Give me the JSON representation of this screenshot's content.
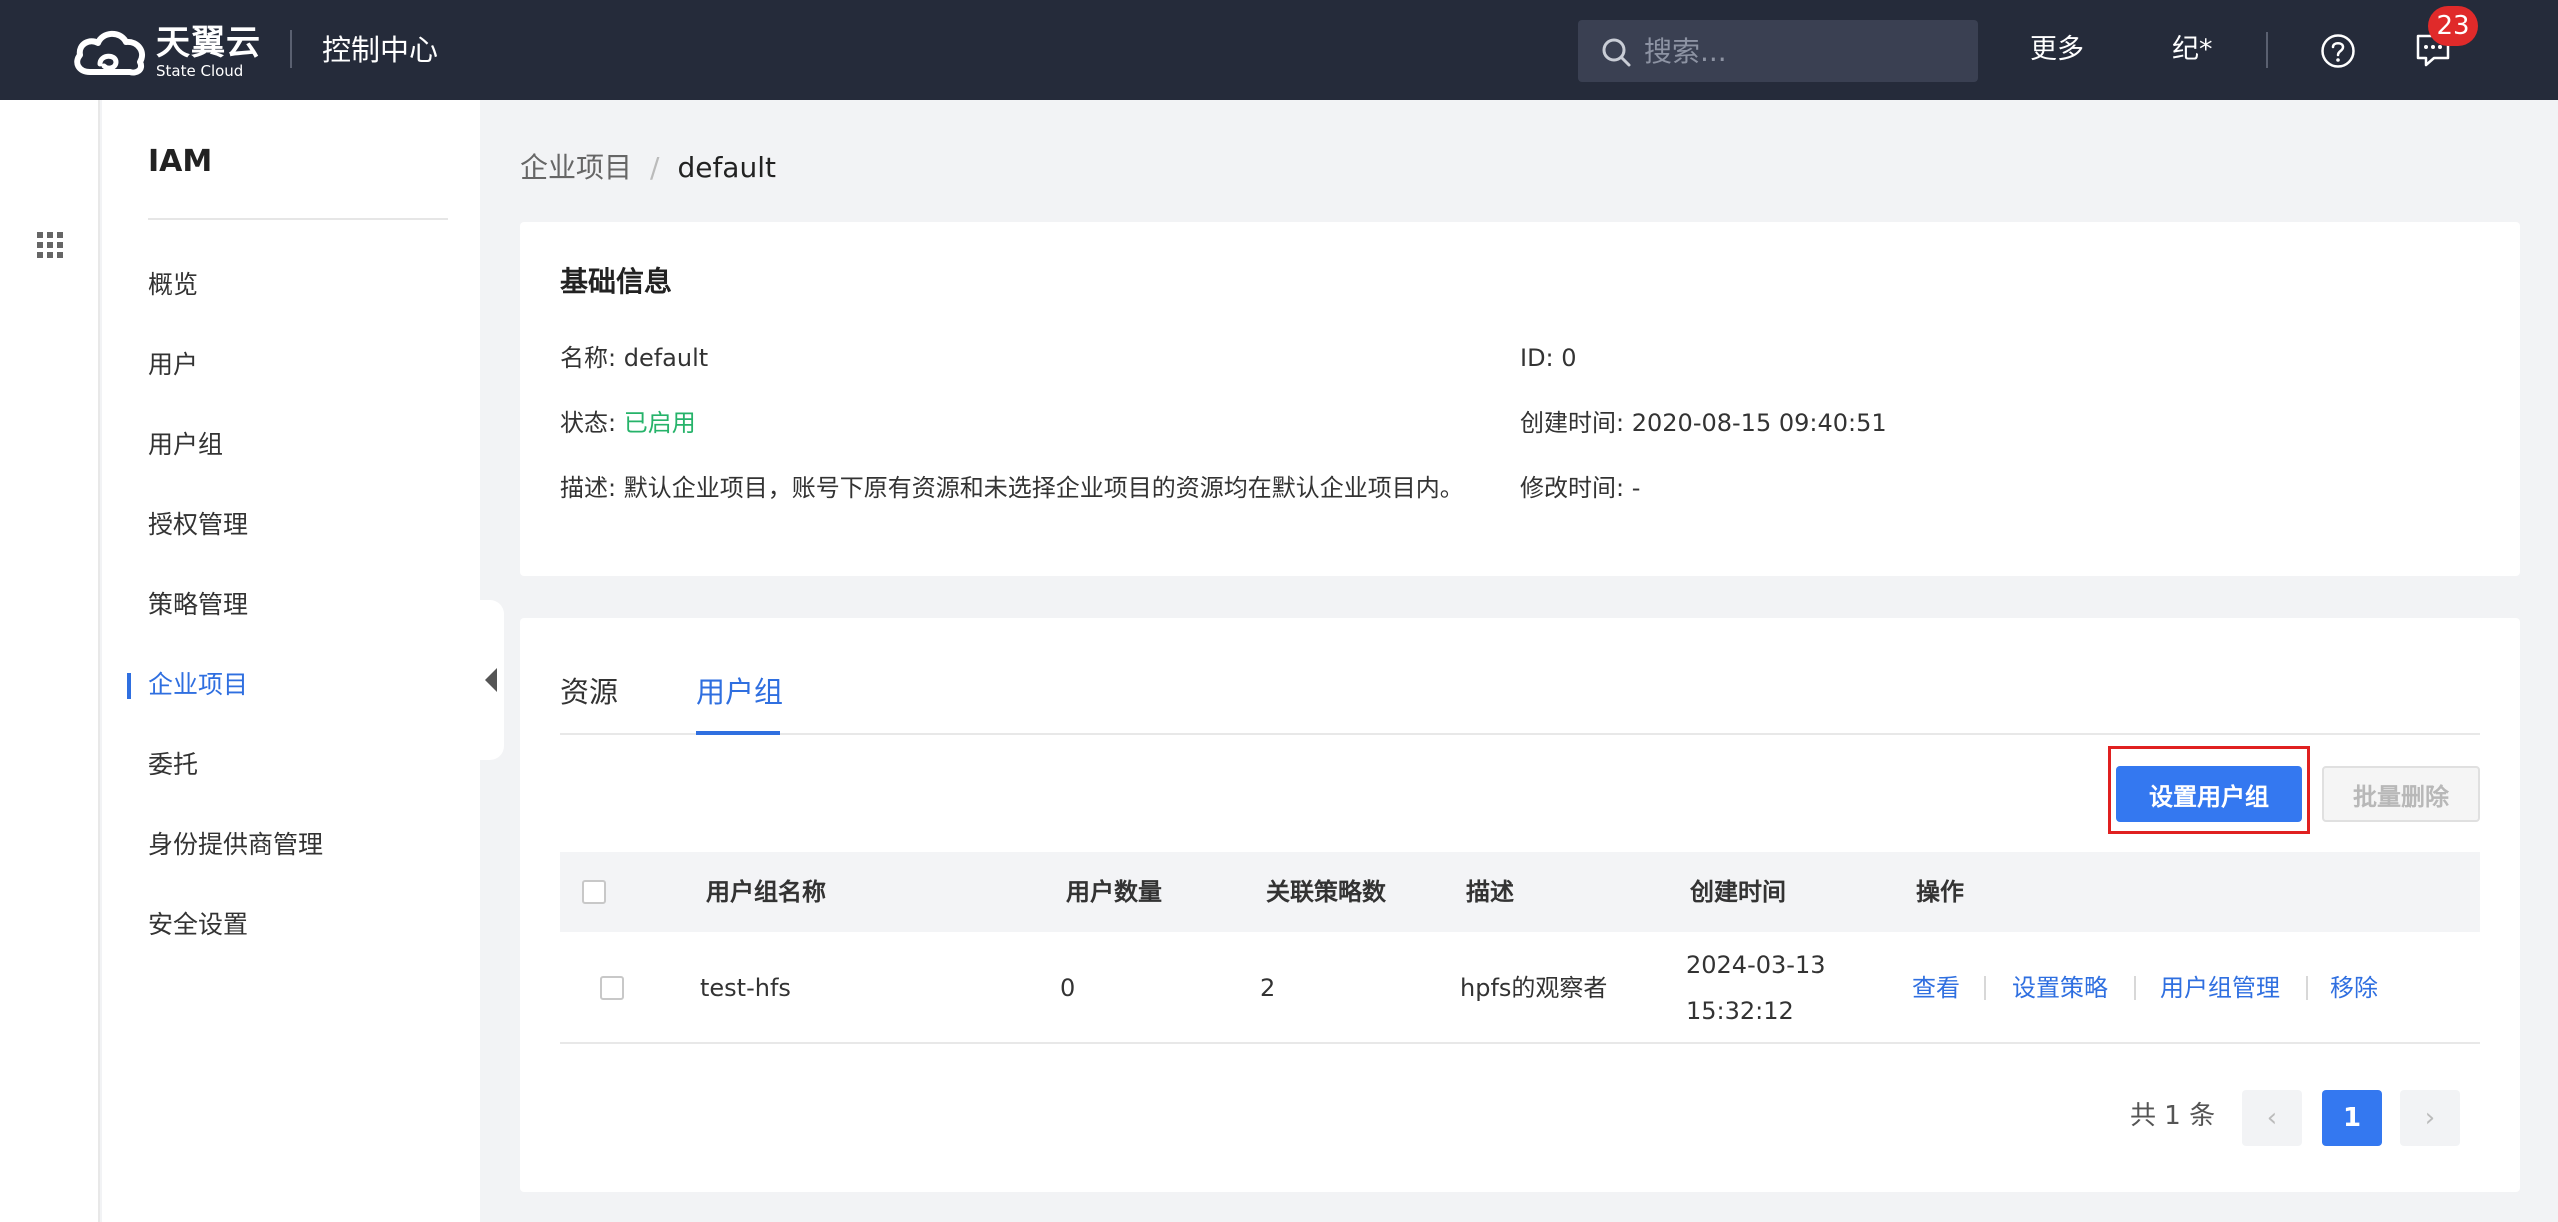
{
  "topbar": {
    "logo_cn": "天翼云",
    "logo_en": "State Cloud",
    "console_title": "控制中心",
    "search_placeholder": "搜索...",
    "more": "更多",
    "user": "纪*",
    "help_icon": "question-circle-icon",
    "message_icon": "chat-bubble-icon",
    "message_badge": "23",
    "background_color": "#252b3a",
    "badge_color": "#e02a2a"
  },
  "leftstrip": {
    "icon": "grid-icon"
  },
  "sidenav": {
    "title": "IAM",
    "items": [
      {
        "label": "概览"
      },
      {
        "label": "用户"
      },
      {
        "label": "用户组"
      },
      {
        "label": "授权管理"
      },
      {
        "label": "策略管理"
      },
      {
        "label": "企业项目",
        "active": true
      },
      {
        "label": "委托"
      },
      {
        "label": "身份提供商管理"
      },
      {
        "label": "安全设置"
      }
    ],
    "active_color": "#2f6fe0"
  },
  "breadcrumb": {
    "parent": "企业项目",
    "separator": "/",
    "current": "default"
  },
  "basic_info": {
    "title": "基础信息",
    "name_label": "名称:",
    "name_value": "default",
    "id_label": "ID:",
    "id_value": "0",
    "status_label": "状态:",
    "status_value": "已启用",
    "status_color": "#26b36a",
    "created_label": "创建时间:",
    "created_value": "2020-08-15 09:40:51",
    "desc_label": "描述:",
    "desc_value": "默认企业项目，账号下原有资源和未选择企业项目的资源均在默认企业项目内。",
    "modified_label": "修改时间:",
    "modified_value": "-"
  },
  "tabs": {
    "items": [
      {
        "label": "资源"
      },
      {
        "label": "用户组",
        "active": true
      }
    ]
  },
  "toolbar": {
    "set_usergroup": "设置用户组",
    "batch_delete": "批量删除",
    "primary_color": "#3478f0",
    "highlight_color": "#e02020"
  },
  "table": {
    "headers": [
      "用户组名称",
      "用户数量",
      "关联策略数",
      "描述",
      "创建时间",
      "操作"
    ],
    "rows": [
      {
        "name": "test-hfs",
        "user_count": "0",
        "policy_count": "2",
        "description": "hpfs的观察者",
        "created": "2024-03-13 15:32:12",
        "actions": [
          "查看",
          "设置策略",
          "用户组管理",
          "移除"
        ]
      }
    ]
  },
  "pagination": {
    "total": "共 1 条",
    "prev": "‹",
    "current": "1",
    "next": "›"
  }
}
